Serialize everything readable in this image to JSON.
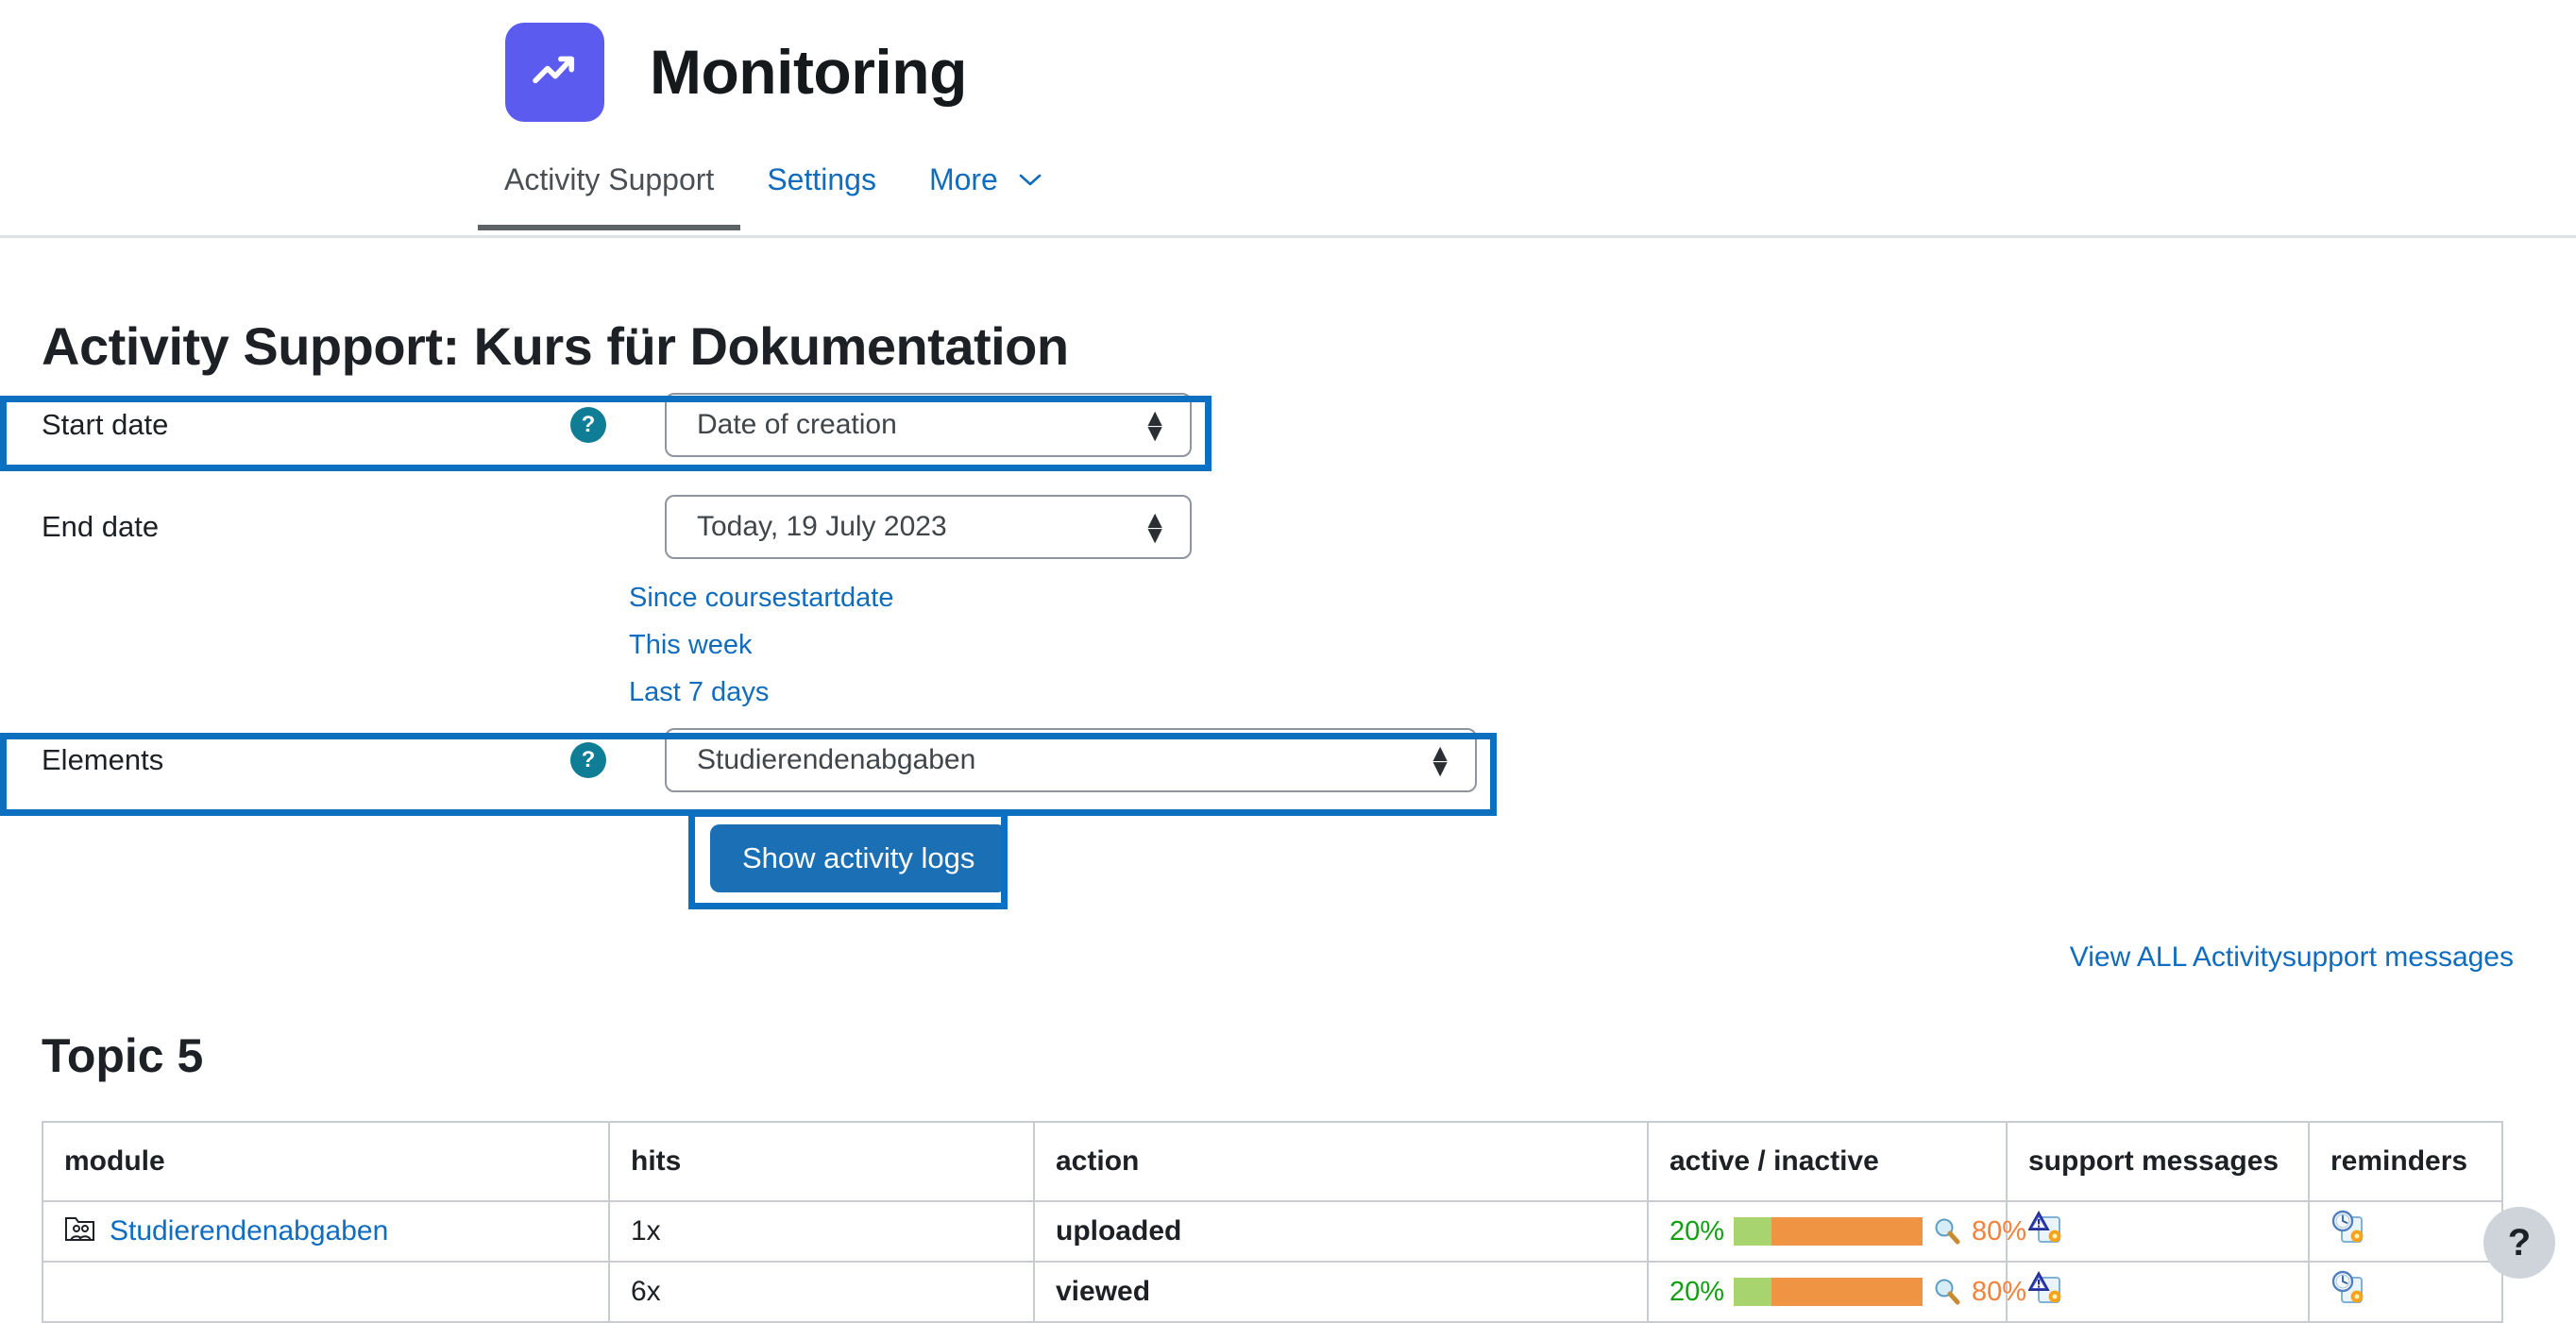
{
  "header": {
    "app_title": "Monitoring",
    "logo_icon": "trending-up-icon",
    "logo_color": "#5b5bef"
  },
  "tabs": [
    {
      "label": "Activity Support",
      "active": true
    },
    {
      "label": "Settings",
      "active": false
    },
    {
      "label": "More",
      "active": false,
      "caret": "⌄"
    }
  ],
  "page": {
    "title": "Activity Support: Kurs für Dokumentation",
    "topic_title": "Topic 5",
    "view_all_link": "View ALL Activitysupport messages",
    "help_badge_char": "?",
    "help_badge_color": "#0f7d95",
    "fab_help_char": "?"
  },
  "form": {
    "start_date": {
      "label": "Start date",
      "value": "Date of creation",
      "highlighted": true
    },
    "end_date": {
      "label": "End date",
      "value": "Today, 19 July 2023",
      "highlighted": false
    },
    "quick_links": [
      "Since coursestartdate",
      "This week",
      "Last 7 days"
    ],
    "elements": {
      "label": "Elements",
      "value": "Studierendenabgaben",
      "highlighted": true
    },
    "submit_button": "Show activity logs"
  },
  "table": {
    "columns": [
      "module",
      "hits",
      "action",
      "active / inactive",
      "support messages",
      "reminders"
    ],
    "rows": [
      {
        "module": "Studierendenabgaben",
        "module_icon": "folder-users-icon",
        "hits": "1x",
        "action": "uploaded",
        "active_pct": "20%",
        "inactive_pct": "80%",
        "active_value": 20,
        "inactive_value": 80,
        "magnifier_icon": "magnifier-icon",
        "support_icon": "warning-document-gear-icon",
        "reminder_icon": "clock-document-gear-icon"
      },
      {
        "module": "",
        "module_icon": "",
        "hits": "6x",
        "action": "viewed",
        "active_pct": "20%",
        "inactive_pct": "80%",
        "active_value": 20,
        "inactive_value": 80,
        "magnifier_icon": "magnifier-icon",
        "support_icon": "warning-document-gear-icon",
        "reminder_icon": "clock-document-gear-icon"
      }
    ]
  },
  "colors": {
    "accent_blue": "#0f6cbf",
    "highlight_blue": "#0d6fc0",
    "button_blue": "#1b6fb5",
    "active_green": "#12a012",
    "inactive_orange": "#f2813c",
    "bar_green": "#a8d470",
    "bar_orange": "#ee9442"
  }
}
